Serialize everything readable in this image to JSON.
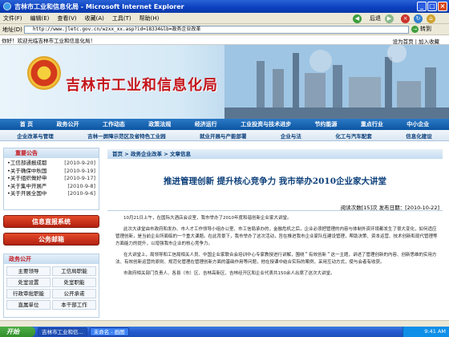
{
  "window": {
    "title": "吉林市工业和信息化局 - Microsoft Internet Explorer",
    "controls": {
      "min": "_",
      "max": "□",
      "close": "×"
    }
  },
  "menu": {
    "items": [
      "文件(F)",
      "编辑(E)",
      "查看(V)",
      "收藏(A)",
      "工具(T)",
      "帮助(H)"
    ],
    "back_label": "后退",
    "forward_label": "→"
  },
  "address": {
    "label": "地址(D)",
    "url": "http://www.jletc.gov.cn/wzxx_xx.asp?id=18334&lb=政务企业改革",
    "go_label": "转到"
  },
  "welcome": {
    "left": "你好！欢迎光临吉林市工业和信息化局！",
    "right": "设为首页 | 加入收藏"
  },
  "banner": {
    "site_title": "吉林市工业和信息化局"
  },
  "nav_main": [
    "首 页",
    "政务公开",
    "工作动态",
    "政策法规",
    "经济运行",
    "工业投资与技术进步",
    "节约能源",
    "重点行业",
    "中小企业"
  ],
  "nav_sub": [
    "企业改革与管理",
    "吉林一屏障示范区及省特色工业园",
    "就业开展与产能部署",
    "企业与法",
    "化工与汽车配套",
    "信息化建设"
  ],
  "notice": {
    "header": "重要公告",
    "items": [
      {
        "title": "工信部通报成都",
        "date": "[2010-9-20]"
      },
      {
        "title": "关于确保中秋国",
        "date": "[2010-9-19]"
      },
      {
        "title": "关于组织做好申",
        "date": "[2010-9-17]"
      },
      {
        "title": "关于集中开展严",
        "date": "[2010-9-8]"
      },
      {
        "title": "关于开展全国中",
        "date": "[2010-9-6]"
      }
    ]
  },
  "buttons": {
    "live": "信息直报系统",
    "contact": "公务邮箱"
  },
  "pubbox": {
    "header": "政务公开",
    "items": [
      "主要领导",
      "工信局职能",
      "处室设置",
      "处室职能",
      "行政审批职能",
      "公开承诺",
      "直属单位",
      "本干部工作"
    ]
  },
  "breadcrumb": "首页 > 政务企业改革 > 文章信息",
  "article": {
    "title": "推进管理创新 提升核心竞争力 我市举办2010企业家大讲堂",
    "meta": "阅读次数[15]次 发布日期：[2010-10-22]",
    "paragraphs": [
      "10月21日上午，在国际大酒店会议室，我市举办了2010年度和谐创新企业家大讲堂。",
      "此次大讲堂由市政府和发办、市人才工作领导小组办公室、市工信局承办的，金融危机之后，企业必须把管理的内容与体制外资环境都发生了很大变化，如何适应管理创新，是当前企业所面临的一个重大课题。在此背景下，我市举办了这次活动，旨在推进我市企业家队伍建设管理，帮助决策、资本运营、技术创新和现代管理等方面能力的提升，以增强我市企业的核心竞争力。",
      "在大讲堂上，局领导和工信局相关人员、中国企业家联合会培训中心专家教授进行讲解，围绕＂有效创新＂这一主题，讲述了管理创新的内容、创新思维的实用方法、有效创新运营的原则、规范化管理在管理创新方面的基础作用等问题，他在授课中结合实际的案例，采用互动方式，使与会者有收获。",
      "市政府相关部门负责人、各县（市）区、吉林高新区、吉林经开区和企业代表共150余人出席了这次大讲堂。"
    ]
  },
  "taskbar": {
    "start": "开始",
    "tasks": [
      "吉林市工业和信...",
      "未命名 - 画图"
    ],
    "clock": "9:41 AM"
  },
  "colors": {
    "brand_red": "#c4161c",
    "nav_blue": "#0d56a3",
    "xp_blue": "#245bd0"
  }
}
